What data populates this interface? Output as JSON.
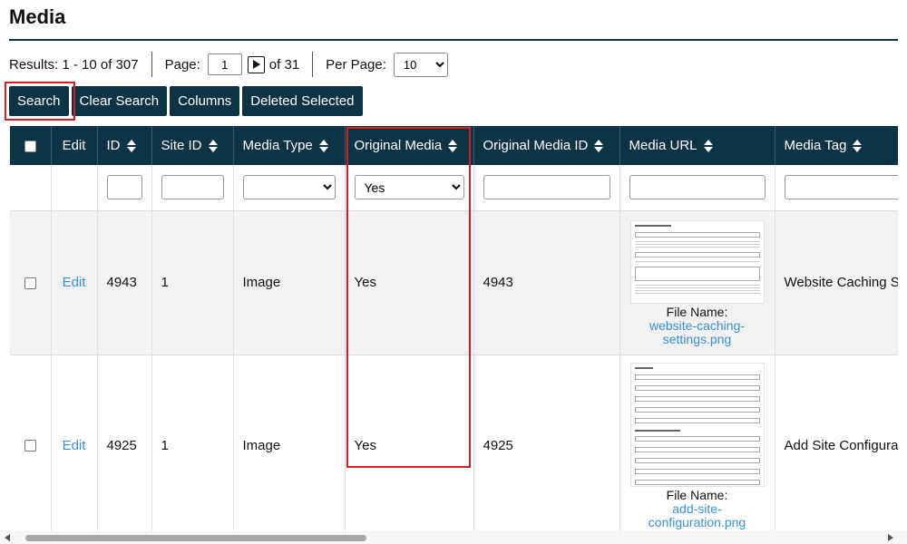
{
  "page": {
    "title": "Media"
  },
  "pager": {
    "results": "Results: 1 - 10 of 307",
    "page_label": "Page:",
    "page_value": "1",
    "of_label": "of 31",
    "per_page_label": "Per Page:",
    "per_page_value": "10"
  },
  "toolbar": {
    "search_label": "Search",
    "clear_label": "Clear Search",
    "columns_label": "Columns",
    "deleted_label": "Deleted Selected"
  },
  "table": {
    "columns": {
      "edit": "Edit",
      "id": "ID",
      "site_id": "Site ID",
      "media_type": "Media Type",
      "original_media": "Original Media",
      "original_media_id": "Original Media ID",
      "media_url": "Media URL",
      "media_tag": "Media Tag"
    },
    "filters": {
      "original_media": "Yes"
    },
    "rows": [
      {
        "edit": "Edit",
        "id": "4943",
        "site_id": "1",
        "media_type": "Image",
        "original_media": "Yes",
        "original_media_id": "4943",
        "file_name_label": "File Name:",
        "file_name": "website-caching-settings.png",
        "media_tag": "Website Caching S"
      },
      {
        "edit": "Edit",
        "id": "4925",
        "site_id": "1",
        "media_type": "Image",
        "original_media": "Yes",
        "original_media_id": "4925",
        "file_name_label": "File Name:",
        "file_name": "add-site-configuration.png",
        "media_tag": "Add Site Configura"
      }
    ]
  },
  "colors": {
    "header_bg": "#0d3347",
    "link": "#3a8fd8",
    "highlight": "#d01f26"
  }
}
